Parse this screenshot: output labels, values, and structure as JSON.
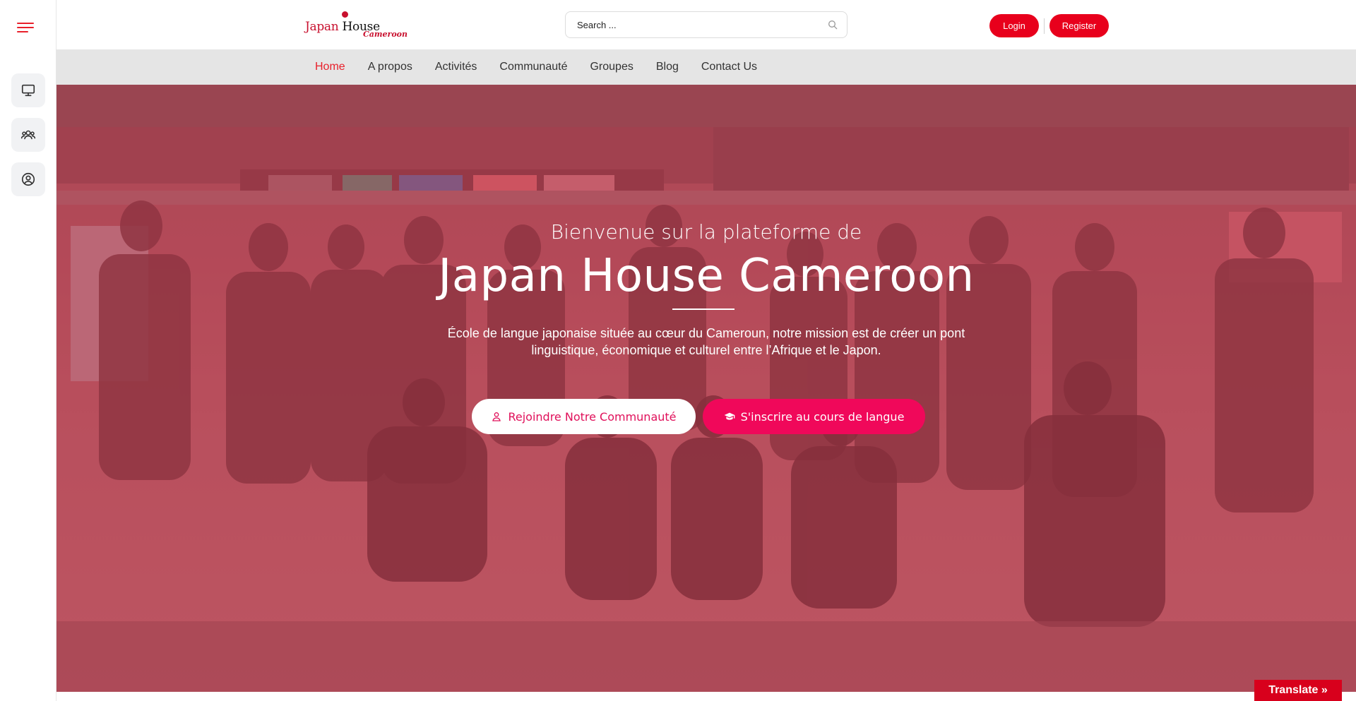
{
  "header": {
    "logo_primary": "Japan",
    "logo_secondary": "House",
    "logo_subtitle": "Cameroon",
    "search": {
      "placeholder": "Search ..."
    },
    "login_label": "Login",
    "register_label": "Register"
  },
  "nav": {
    "items": [
      {
        "label": "Home",
        "active": true
      },
      {
        "label": "A propos"
      },
      {
        "label": "Activités"
      },
      {
        "label": "Communauté"
      },
      {
        "label": "Groupes"
      },
      {
        "label": "Blog"
      },
      {
        "label": "Contact Us"
      }
    ]
  },
  "sidebar": {
    "items": [
      {
        "icon": "monitor-icon"
      },
      {
        "icon": "users-icon"
      },
      {
        "icon": "user-circle-icon"
      }
    ]
  },
  "hero": {
    "pre_title": "Bienvenue sur la plateforme de",
    "title": "Japan House Cameroon",
    "description": "École de langue japonaise située au cœur du Cameroun, notre mission est de créer un pont linguistique, économique et culturel entre l’Afrique et le Japon.",
    "join_label": "Rejoindre Notre Communauté",
    "enroll_label": "S'inscrire au cours de langue"
  },
  "translate_label": "Translate »",
  "colors": {
    "accent": "#e8202b",
    "button_red": "#e8001c",
    "hero_pink": "#f0085a"
  }
}
